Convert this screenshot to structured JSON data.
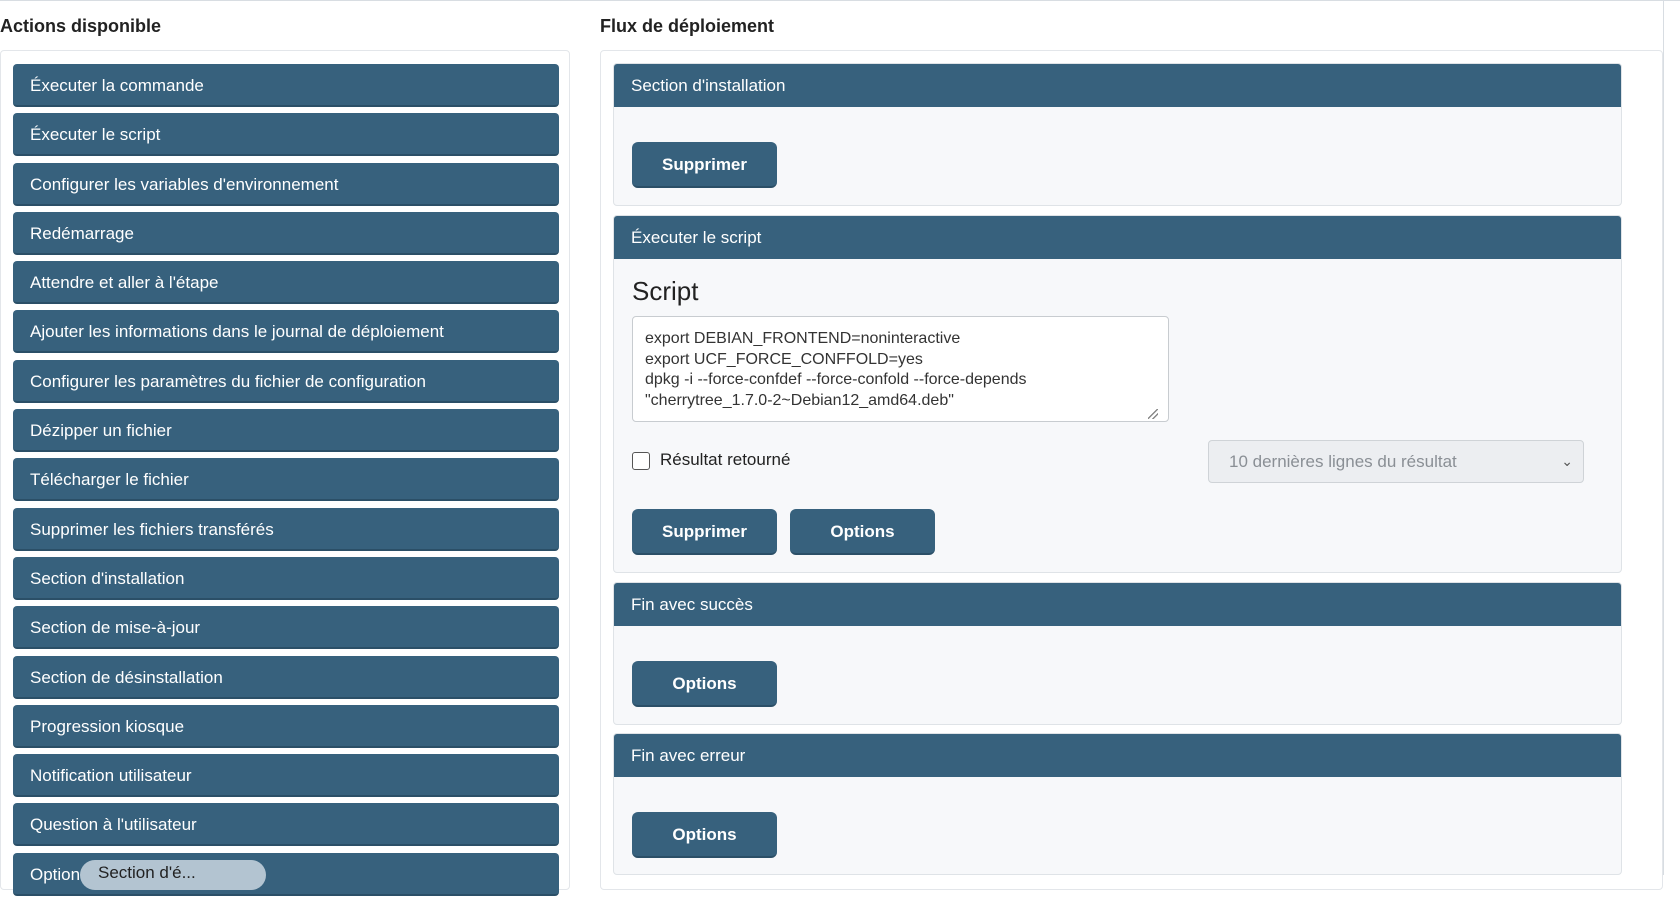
{
  "left_column": {
    "title": "Actions disponible",
    "actions": [
      "Éxecuter la commande",
      "Éxecuter le script",
      "Configurer les variables d'environnement",
      "Redémarrage",
      "Attendre et aller à l'étape",
      "Ajouter les informations dans le journal de déploiement",
      "Configurer les paramètres du fichier de configuration",
      "Dézipper un fichier",
      "Télécharger le fichier",
      "Supprimer les fichiers transférés",
      "Section d'installation",
      "Section de mise-à-jour",
      "Section de désinstallation",
      "Progression kiosque",
      "Notification utilisateur",
      "Question à l'utilisateur",
      "Option"
    ],
    "drag_tooltip": "Section d'é..."
  },
  "right_column": {
    "title": "Flux de déploiement",
    "sections": {
      "install": {
        "header": "Section d'installation",
        "delete_label": "Supprimer"
      },
      "script": {
        "header": "Éxecuter le script",
        "label": "Script",
        "content": "export DEBIAN_FRONTEND=noninteractive\nexport UCF_FORCE_CONFFOLD=yes\ndpkg -i --force-confdef --force-confold --force-depends\n\"cherrytree_1.7.0-2~Debian12_amd64.deb\"",
        "return_result_label": "Résultat retourné",
        "return_result_checked": false,
        "result_select_value": "10 dernières lignes du résultat",
        "delete_label": "Supprimer",
        "options_label": "Options"
      },
      "success": {
        "header": "Fin avec succès",
        "options_label": "Options"
      },
      "error": {
        "header": "Fin avec erreur",
        "options_label": "Options"
      }
    }
  },
  "colors": {
    "accent": "#37617d",
    "panel_bg": "#f7f8fa"
  }
}
